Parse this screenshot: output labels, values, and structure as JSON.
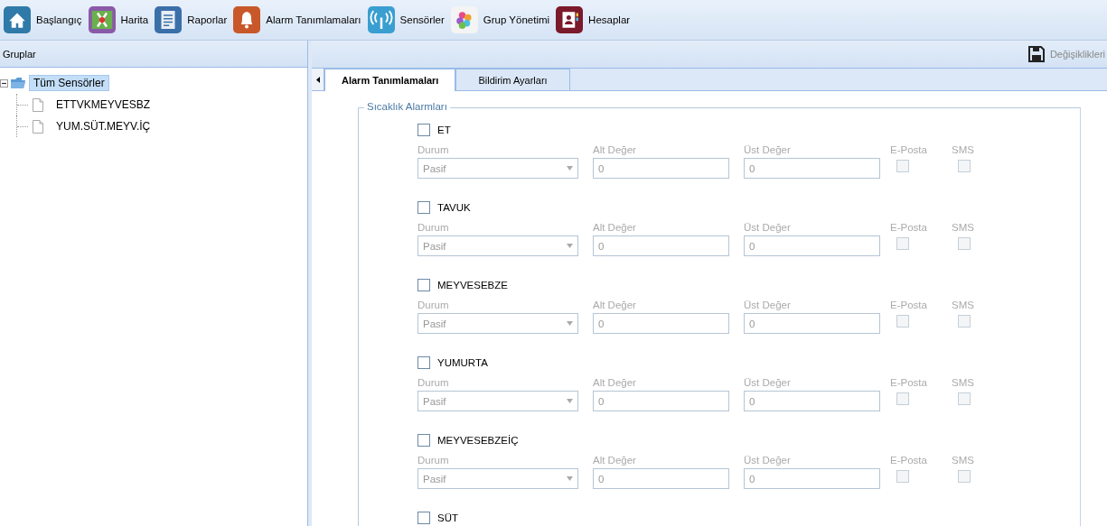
{
  "toolbar": [
    {
      "label": "Başlangıç"
    },
    {
      "label": "Harita"
    },
    {
      "label": "Raporlar"
    },
    {
      "label": "Alarm Tanımlamaları"
    },
    {
      "label": "Sensörler"
    },
    {
      "label": "Grup Yönetimi"
    },
    {
      "label": "Hesaplar"
    }
  ],
  "sidebar": {
    "title": "Gruplar",
    "tree": [
      {
        "label": "Tüm Sensörler",
        "selected": true,
        "expanded": true,
        "children": [
          {
            "label": "ETTVKMEYVESBZ",
            "selected": false
          },
          {
            "label": "YUM.SÜT.MEYV.İÇ",
            "selected": false
          }
        ]
      }
    ]
  },
  "header": {
    "save_label": "Değişiklikleri"
  },
  "tabs": [
    {
      "label": "Alarm Tanımlamaları",
      "selected": true
    },
    {
      "label": "Bildirim Ayarları",
      "selected": false
    }
  ],
  "fieldset": {
    "legend": "Sıcaklık Alarmları",
    "alarms": [
      {
        "name": "ET",
        "checked": false,
        "fields": {
          "disabled": true,
          "status_label": "Durum",
          "status": "Pasif",
          "low_label": "Alt Değer",
          "low": "0",
          "high_label": "Üst Değer",
          "high": "0",
          "email_label": "E-Posta",
          "email": false,
          "sms_label": "SMS",
          "sms": false
        }
      },
      {
        "name": "TAVUK",
        "checked": false,
        "fields": {
          "disabled": true,
          "status_label": "Durum",
          "status": "Pasif",
          "low_label": "Alt Değer",
          "low": "0",
          "high_label": "Üst Değer",
          "high": "0",
          "email_label": "E-Posta",
          "email": false,
          "sms_label": "SMS",
          "sms": false
        }
      },
      {
        "name": "MEYVESEBZE",
        "checked": false,
        "fields": {
          "disabled": true,
          "status_label": "Durum",
          "status": "Pasif",
          "low_label": "Alt Değer",
          "low": "0",
          "high_label": "Üst Değer",
          "high": "0",
          "email_label": "E-Posta",
          "email": false,
          "sms_label": "SMS",
          "sms": false
        }
      },
      {
        "name": "YUMURTA",
        "checked": false,
        "fields": {
          "disabled": true,
          "status_label": "Durum",
          "status": "Pasif",
          "low_label": "Alt Değer",
          "low": "0",
          "high_label": "Üst Değer",
          "high": "0",
          "email_label": "E-Posta",
          "email": false,
          "sms_label": "SMS",
          "sms": false
        }
      },
      {
        "name": "MEYVESEBZEİÇ",
        "checked": false,
        "fields": {
          "disabled": true,
          "status_label": "Durum",
          "status": "Pasif",
          "low_label": "Alt Değer",
          "low": "0",
          "high_label": "Üst Değer",
          "high": "0",
          "email_label": "E-Posta",
          "email": false,
          "sms_label": "SMS",
          "sms": false
        }
      },
      {
        "name": "SÜT",
        "checked": false
      }
    ]
  }
}
